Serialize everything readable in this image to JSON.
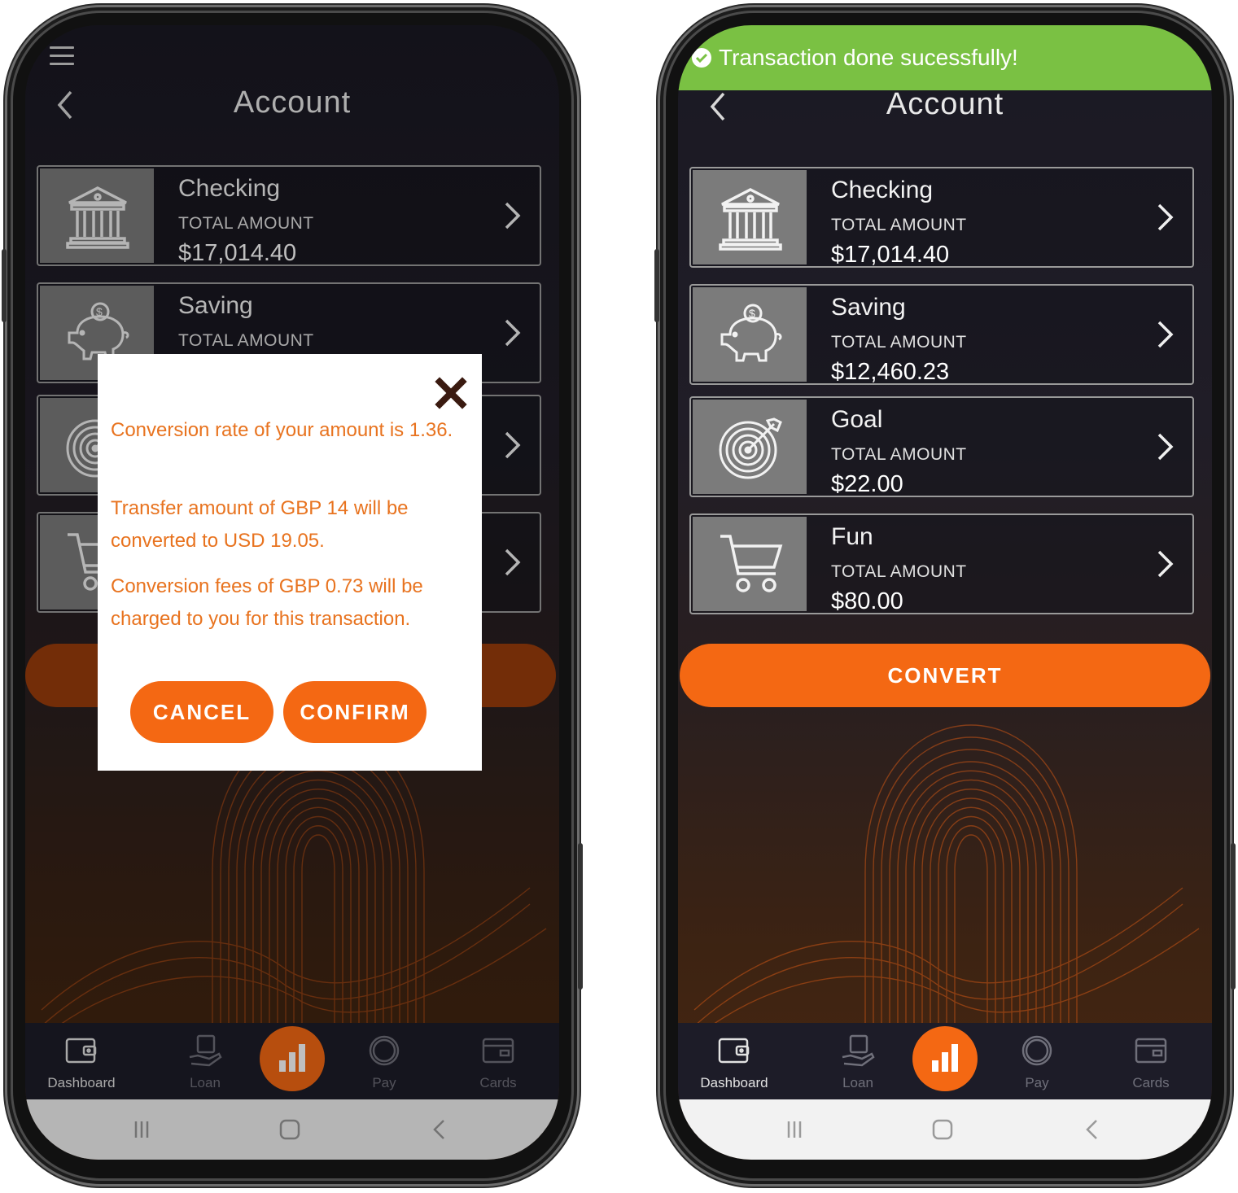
{
  "left_phone": {
    "title": "Account",
    "accounts": [
      {
        "name": "Checking",
        "label": "TOTAL AMOUNT",
        "amount": "$17,014.40"
      },
      {
        "name": "Saving",
        "label": "TOTAL AMOUNT",
        "amount": ""
      }
    ],
    "dialog": {
      "rate_text": "Conversion rate of your amount is 1.36.",
      "transfer_text": "Transfer amount of GBP 14 will be converted to USD 19.05.",
      "fees_text": "Conversion fees of GBP 0.73 will be charged to you for this transaction.",
      "cancel_label": "CANCEL",
      "confirm_label": "CONFIRM"
    }
  },
  "right_phone": {
    "toast": "Transaction done sucessfully!",
    "title": "Account",
    "accounts": [
      {
        "name": "Checking",
        "label": "TOTAL AMOUNT",
        "amount": "$17,014.40",
        "icon": "bank-icon"
      },
      {
        "name": "Saving",
        "label": "TOTAL AMOUNT",
        "amount": "$12,460.23",
        "icon": "piggy-bank-icon"
      },
      {
        "name": "Goal",
        "label": "TOTAL AMOUNT",
        "amount": "$22.00",
        "icon": "target-icon"
      },
      {
        "name": "Fun",
        "label": "TOTAL AMOUNT",
        "amount": "$80.00",
        "icon": "cart-icon"
      }
    ],
    "convert_label": "CONVERT"
  },
  "nav": {
    "dashboard": "Dashboard",
    "loan": "Loan",
    "pay": "Pay",
    "cards": "Cards"
  },
  "colors": {
    "accent": "#f46813",
    "success": "#7ac143",
    "dialog_text": "#e8731f",
    "background": "#1a1923"
  }
}
